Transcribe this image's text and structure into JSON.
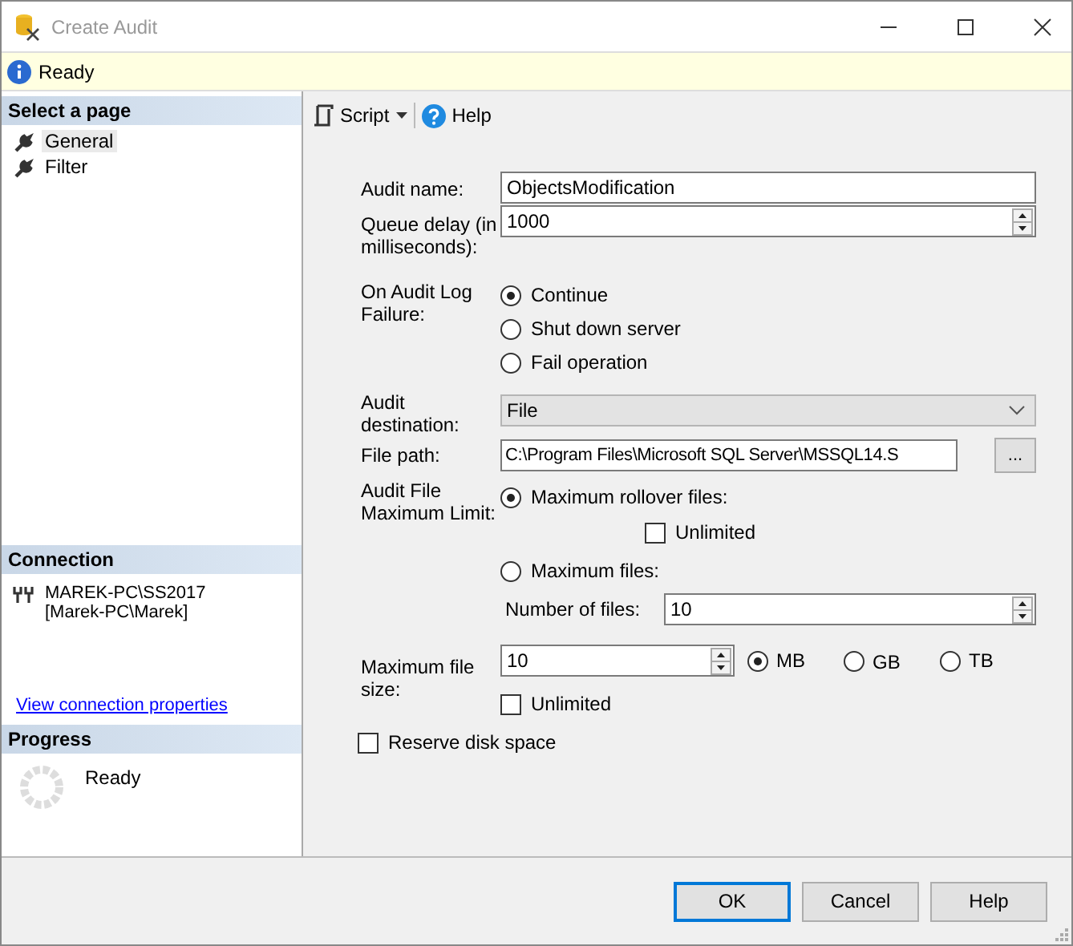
{
  "window": {
    "title": "Create Audit"
  },
  "info_bar": {
    "text": "Ready"
  },
  "select_page": {
    "heading": "Select a page",
    "items": [
      {
        "label": "General",
        "selected": true
      },
      {
        "label": "Filter",
        "selected": false
      }
    ]
  },
  "connection": {
    "heading": "Connection",
    "server": "MAREK-PC\\SS2017",
    "user": "[Marek-PC\\Marek]",
    "link": "View connection properties"
  },
  "progress": {
    "heading": "Progress",
    "status": "Ready"
  },
  "toolbar": {
    "script": "Script",
    "help": "Help"
  },
  "form": {
    "audit_name": {
      "label": "Audit name:",
      "value": "ObjectsModification"
    },
    "queue_delay": {
      "label": "Queue delay (in milliseconds):",
      "value": "1000"
    },
    "on_failure": {
      "label": "On Audit Log Failure:",
      "options": [
        {
          "label": "Continue",
          "selected": true
        },
        {
          "label": "Shut down server",
          "selected": false
        },
        {
          "label": "Fail operation",
          "selected": false
        }
      ]
    },
    "destination": {
      "label": "Audit destination:",
      "value": "File"
    },
    "file_path": {
      "label": "File path:",
      "value": "C:\\Program Files\\Microsoft SQL Server\\MSSQL14.S",
      "browse": "..."
    },
    "max_limit": {
      "label": "Audit File Maximum Limit:",
      "rollover": {
        "label": "Maximum rollover files:",
        "selected": true,
        "unlimited": {
          "label": "Unlimited",
          "checked": false
        }
      },
      "max_files": {
        "label": "Maximum files:",
        "selected": false,
        "number_label": "Number of files:",
        "number_value": "10"
      }
    },
    "max_size": {
      "label": "Maximum file size:",
      "value": "10",
      "units": [
        {
          "label": "MB",
          "selected": true
        },
        {
          "label": "GB",
          "selected": false
        },
        {
          "label": "TB",
          "selected": false
        }
      ],
      "unlimited": {
        "label": "Unlimited",
        "checked": false
      }
    },
    "reserve": {
      "label": "Reserve disk space",
      "checked": false
    }
  },
  "buttons": [
    {
      "label": "OK",
      "default": true
    },
    {
      "label": "Cancel",
      "default": false
    },
    {
      "label": "Help",
      "default": false
    }
  ]
}
